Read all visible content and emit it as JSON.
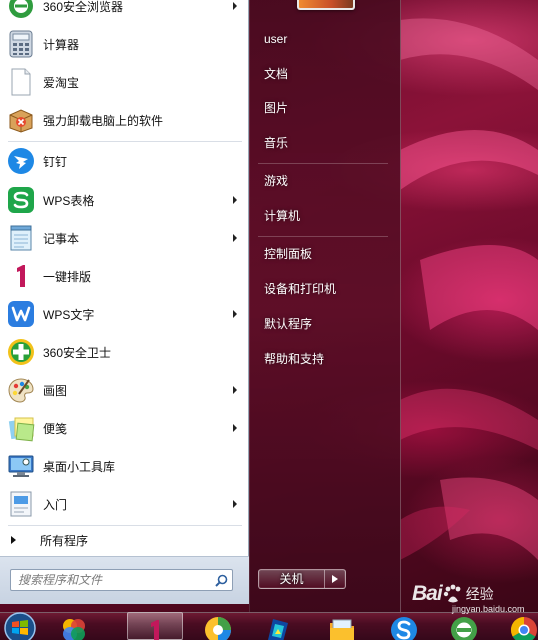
{
  "start_menu": {
    "programs": [
      {
        "label": "360安全浏览器",
        "icon": "360-browser-icon",
        "submenu": true
      },
      {
        "label": "计算器",
        "icon": "calculator-icon",
        "submenu": false
      },
      {
        "label": "爱淘宝",
        "icon": "blank-page-icon",
        "submenu": false
      },
      {
        "label": "强力卸载电脑上的软件",
        "icon": "uninstall-box-icon",
        "submenu": false
      },
      {
        "label": "钉钉",
        "icon": "dingtalk-icon",
        "submenu": false
      },
      {
        "label": "WPS表格",
        "icon": "wps-spreadsheet-icon",
        "submenu": true
      },
      {
        "label": "记事本",
        "icon": "notepad-icon",
        "submenu": true
      },
      {
        "label": "一键排版",
        "icon": "one-key-layout-icon",
        "submenu": false
      },
      {
        "label": "WPS文字",
        "icon": "wps-writer-icon",
        "submenu": true
      },
      {
        "label": "360安全卫士",
        "icon": "360-security-icon",
        "submenu": false
      },
      {
        "label": "画图",
        "icon": "paint-palette-icon",
        "submenu": true
      },
      {
        "label": "便笺",
        "icon": "sticky-notes-icon",
        "submenu": true
      },
      {
        "label": "桌面小工具库",
        "icon": "desktop-gadgets-icon",
        "submenu": false
      },
      {
        "label": "入门",
        "icon": "getting-started-icon",
        "submenu": true
      }
    ],
    "all_programs": "所有程序",
    "search": {
      "placeholder": "搜索程序和文件"
    },
    "places": [
      "user",
      "文档",
      "图片",
      "音乐",
      "游戏",
      "计算机",
      "控制面板",
      "设备和打印机",
      "默认程序",
      "帮助和支持"
    ],
    "shutdown_label": "关机"
  },
  "taskbar": {
    "buttons": [
      "start-orb",
      "photo-gallery-icon",
      "one-key-layout-icon",
      "color-app-icon",
      "image-tool-icon",
      "file-manager-icon",
      "sogou-icon",
      "360-browser-icon",
      "chrome-icon"
    ]
  },
  "watermark": {
    "brand": "Bai",
    "brand_suffix": "经验",
    "url": "jingyan.baidu.com"
  },
  "colors": {
    "menu_left_bg": "#ffffff",
    "menu_right_bg": "#5a0e26",
    "wallpaper_accent": "#d81b60",
    "taskbar_bg": "#4a0c22"
  }
}
